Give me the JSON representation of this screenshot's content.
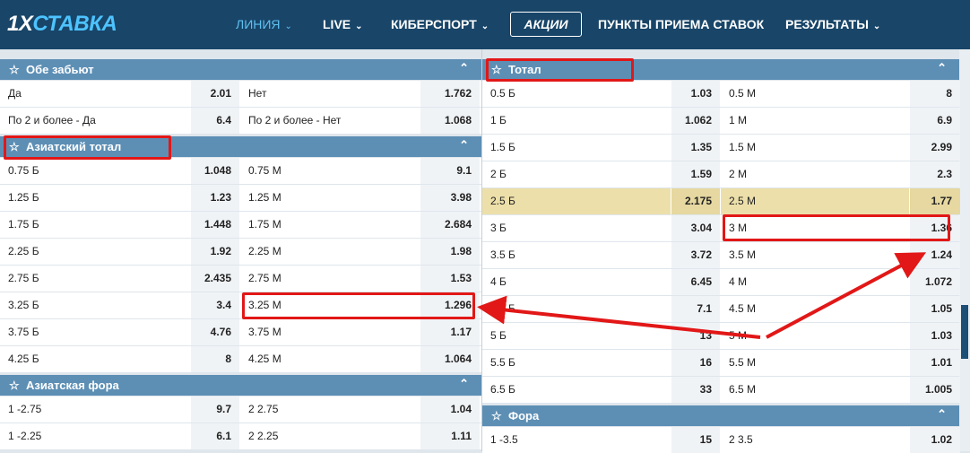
{
  "header": {
    "logo_prefix": "1X",
    "logo_brand": "СТАВКА",
    "nav": [
      "ЛИНИЯ",
      "LIVE",
      "КИБЕРСПОРТ",
      "АКЦИИ",
      "ПУНКТЫ ПРИЕМА СТАВОК",
      "РЕЗУЛЬТАТЫ"
    ]
  },
  "left": {
    "both_score": {
      "title": "Обе забьют",
      "rows": [
        {
          "a": "Да",
          "ao": "2.01",
          "b": "Нет",
          "bo": "1.762"
        },
        {
          "a": "По 2 и более - Да",
          "ao": "6.4",
          "b": "По 2 и более - Нет",
          "bo": "1.068"
        }
      ]
    },
    "asian_total": {
      "title": "Азиатский тотал",
      "rows": [
        {
          "a": "0.75 Б",
          "ao": "1.048",
          "b": "0.75 М",
          "bo": "9.1"
        },
        {
          "a": "1.25 Б",
          "ao": "1.23",
          "b": "1.25 М",
          "bo": "3.98"
        },
        {
          "a": "1.75 Б",
          "ao": "1.448",
          "b": "1.75 М",
          "bo": "2.684"
        },
        {
          "a": "2.25 Б",
          "ao": "1.92",
          "b": "2.25 М",
          "bo": "1.98"
        },
        {
          "a": "2.75 Б",
          "ao": "2.435",
          "b": "2.75 М",
          "bo": "1.53"
        },
        {
          "a": "3.25 Б",
          "ao": "3.4",
          "b": "3.25 М",
          "bo": "1.296"
        },
        {
          "a": "3.75 Б",
          "ao": "4.76",
          "b": "3.75 М",
          "bo": "1.17"
        },
        {
          "a": "4.25 Б",
          "ao": "8",
          "b": "4.25 М",
          "bo": "1.064"
        }
      ]
    },
    "asian_handicap": {
      "title": "Азиатская фора",
      "rows": [
        {
          "a": "1 -2.75",
          "ao": "9.7",
          "b": "2 2.75",
          "bo": "1.04"
        },
        {
          "a": "1 -2.25",
          "ao": "6.1",
          "b": "2 2.25",
          "bo": "1.11"
        }
      ]
    }
  },
  "right": {
    "total": {
      "title": "Тотал",
      "rows": [
        {
          "a": "0.5 Б",
          "ao": "1.03",
          "b": "0.5 М",
          "bo": "8"
        },
        {
          "a": "1 Б",
          "ao": "1.062",
          "b": "1 М",
          "bo": "6.9"
        },
        {
          "a": "1.5 Б",
          "ao": "1.35",
          "b": "1.5 М",
          "bo": "2.99"
        },
        {
          "a": "2 Б",
          "ao": "1.59",
          "b": "2 М",
          "bo": "2.3"
        },
        {
          "a": "2.5 Б",
          "ao": "2.175",
          "b": "2.5 М",
          "bo": "1.77"
        },
        {
          "a": "3 Б",
          "ao": "3.04",
          "b": "3 М",
          "bo": "1.36"
        },
        {
          "a": "3.5 Б",
          "ao": "3.72",
          "b": "3.5 М",
          "bo": "1.24"
        },
        {
          "a": "4 Б",
          "ao": "6.45",
          "b": "4 М",
          "bo": "1.072"
        },
        {
          "a": "4.5 Б",
          "ao": "7.1",
          "b": "4.5 М",
          "bo": "1.05"
        },
        {
          "a": "5 Б",
          "ao": "13",
          "b": "5 М",
          "bo": "1.03"
        },
        {
          "a": "5.5 Б",
          "ao": "16",
          "b": "5.5 М",
          "bo": "1.01"
        },
        {
          "a": "6.5 Б",
          "ao": "33",
          "b": "6.5 М",
          "bo": "1.005"
        }
      ]
    },
    "handicap": {
      "title": "Фора",
      "rows": [
        {
          "a": "1 -3.5",
          "ao": "15",
          "b": "2 3.5",
          "bo": "1.02"
        }
      ]
    }
  },
  "colors": {
    "header_bg": "#184568",
    "group_header": "#5d8fb5",
    "highlight": "#ecdfa9",
    "annotation": "#e21717"
  }
}
